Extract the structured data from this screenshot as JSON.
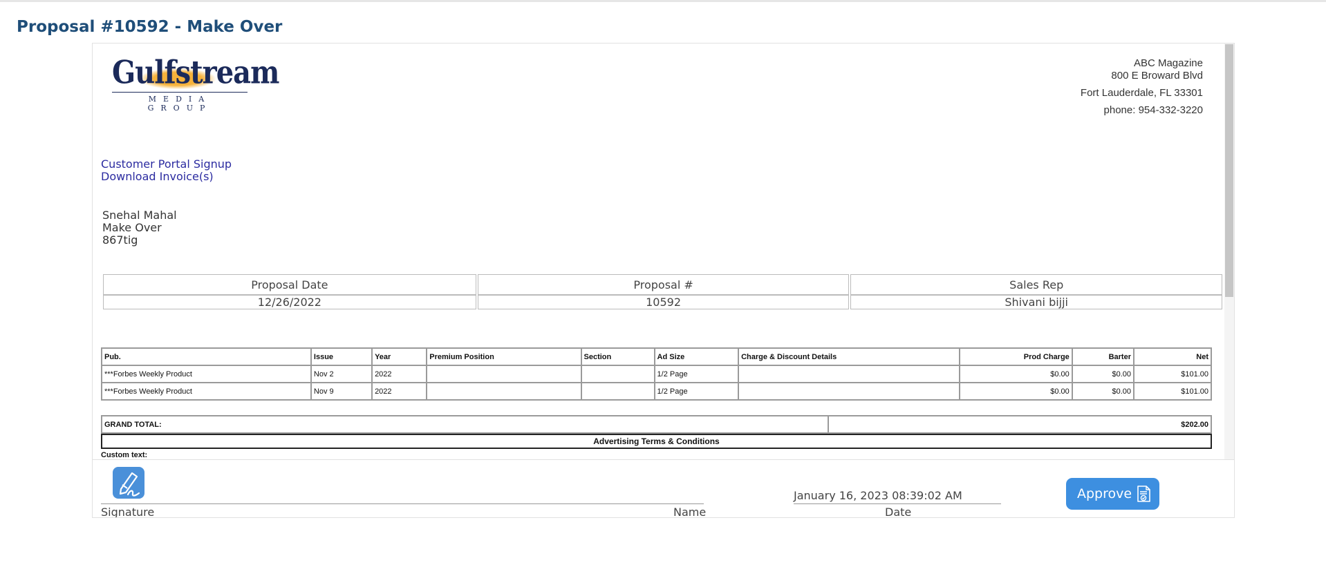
{
  "page": {
    "title": "Proposal #10592 - Make Over"
  },
  "logo": {
    "name": "Gulfstream",
    "tagline": "MEDIA GROUP"
  },
  "address": {
    "company": "ABC Magazine",
    "street": "800 E Broward Blvd",
    "city": "Fort Lauderdale, FL 33301",
    "phone": "phone: 954-332-3220"
  },
  "links": {
    "portal_signup": "Customer Portal Signup",
    "download_invoices": "Download Invoice(s)"
  },
  "customer": {
    "name": "Snehal Mahal",
    "company": "Make Over",
    "line3": "867tig"
  },
  "info": {
    "headers": [
      "Proposal Date",
      "Proposal #",
      "Sales Rep"
    ],
    "values": [
      "12/26/2022",
      "10592",
      "Shivani bijji"
    ]
  },
  "items": {
    "headers": [
      "Pub.",
      "Issue",
      "Year",
      "Premium Position",
      "Section",
      "Ad Size",
      "Charge & Discount Details",
      "Prod Charge",
      "Barter",
      "Net"
    ],
    "rows": [
      [
        "***Forbes Weekly Product",
        "Nov 2",
        "2022",
        "",
        "",
        "1/2 Page",
        "",
        "$0.00",
        "$0.00",
        "$101.00"
      ],
      [
        "***Forbes Weekly Product",
        "Nov 9",
        "2022",
        "",
        "",
        "1/2 Page",
        "",
        "$0.00",
        "$0.00",
        "$101.00"
      ]
    ]
  },
  "totals": {
    "label": "GRAND TOTAL:",
    "value": "$202.00"
  },
  "terms": {
    "title": "Advertising Terms & Conditions",
    "custom_text_label": "Custom text:"
  },
  "signature": {
    "signature_label": "Signature",
    "name_label": "Name",
    "date_value": "January 16, 2023 08:39:02 AM",
    "date_label": "Date",
    "approve_label": "Approve"
  },
  "colors": {
    "title": "#1f4e79",
    "link": "#2b2ba0",
    "approve_button": "#3d8fe0",
    "logo_sun": "#f6b23b"
  },
  "icons": {
    "signature": "signature-pen-icon",
    "approve": "document-check-icon"
  }
}
